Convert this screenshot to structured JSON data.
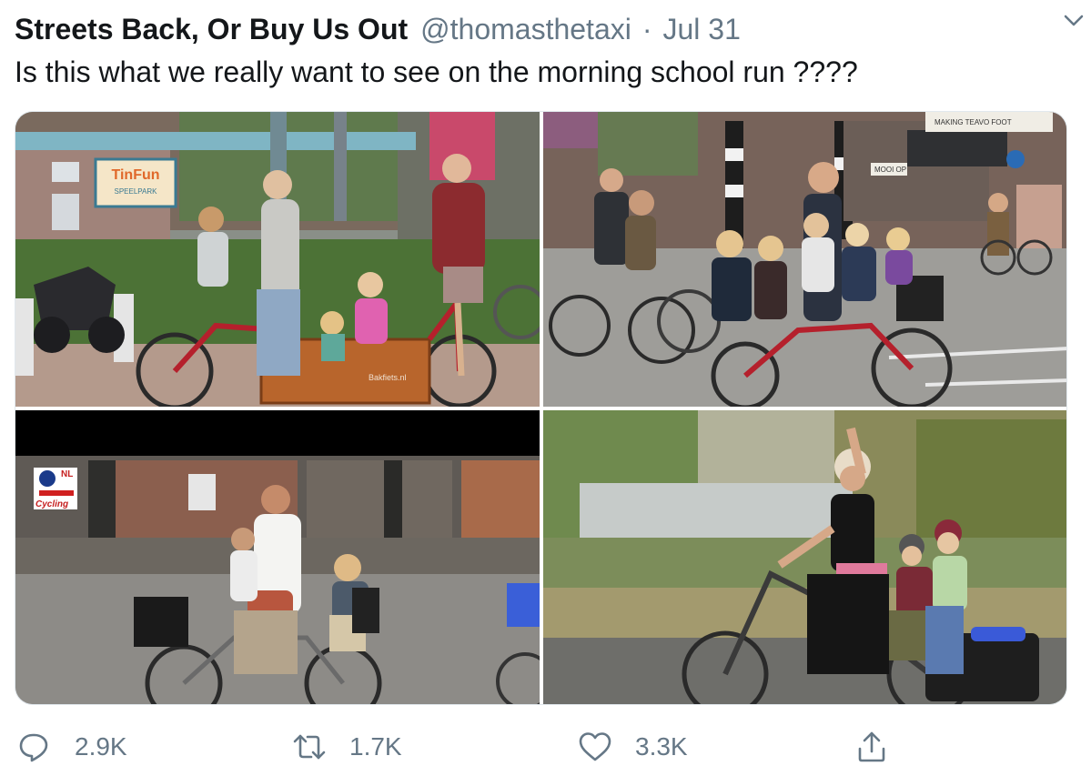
{
  "tweet": {
    "display_name": "Streets Back, Or Buy Us Out",
    "handle": "@thomasthetaxi",
    "separator": "·",
    "date": "Jul 31",
    "text": "Is this what we really want to see on the morning school run ????"
  },
  "photos": [
    {
      "sign_text": "TinFun",
      "sign_sub": "SPEELPARK",
      "bakfiets_text": "Bakfiets.nl"
    },
    {
      "sign_text": "MOOI OP",
      "shop_text": "MAKING TEAVO FOOT"
    },
    {
      "watermark_top": "NL",
      "watermark_bottom": "Cycling"
    },
    {}
  ],
  "actions": {
    "reply_count": "2.9K",
    "retweet_count": "1.7K",
    "like_count": "3.3K"
  },
  "colors": {
    "text_primary": "#14171a",
    "text_secondary": "#657786",
    "border": "#e1e8ed"
  },
  "icons": {
    "menu": "chevron-down-icon",
    "reply": "reply-icon",
    "retweet": "retweet-icon",
    "like": "heart-icon",
    "share": "share-icon"
  }
}
